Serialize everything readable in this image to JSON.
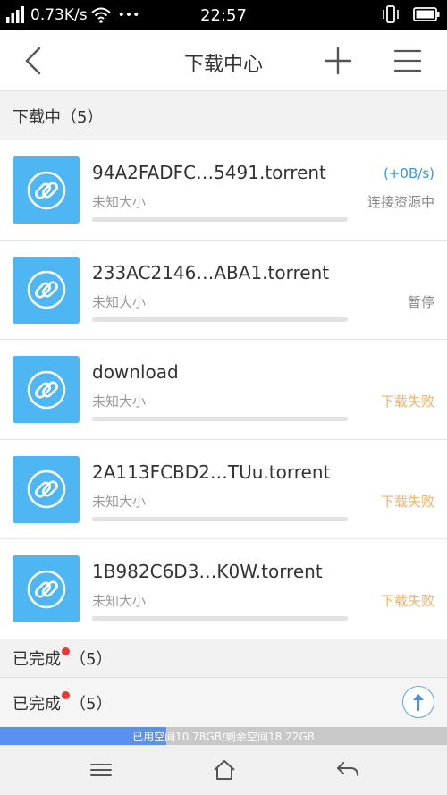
{
  "status_bar": {
    "speed": "0.73K/s",
    "dots": "•••",
    "time": "22:57"
  },
  "header": {
    "title": "下载中心"
  },
  "downloading": {
    "label": "下载中",
    "count": "（5）",
    "items": [
      {
        "name": "94A2FADFC…5491.torrent",
        "size": "未知大小",
        "speed": "(+0B/s)",
        "status": "连接资源中"
      },
      {
        "name": "233AC2146…ABA1.torrent",
        "size": "未知大小",
        "speed": "",
        "status": "暂停"
      },
      {
        "name": "download",
        "size": "未知大小",
        "speed": "",
        "status": "下载失败"
      },
      {
        "name": "2A113FCBD2…TUu.torrent",
        "size": "未知大小",
        "speed": "",
        "status": "下载失败"
      },
      {
        "name": "1B982C6D3…K0W.torrent",
        "size": "未知大小",
        "speed": "",
        "status": "下载失败"
      }
    ]
  },
  "completed": {
    "label": "已完成",
    "count": "（5）"
  },
  "bottom_panel": {
    "label": "已完成",
    "count": "（5）"
  },
  "storage": {
    "text": "已用空间10.78GB/剩余空间18.22GB",
    "used_fraction": 0.372
  },
  "colors": {
    "accent": "#4fb6f4",
    "fail": "#f4b26a",
    "speed": "#2a9ae6",
    "badge": "#e53935"
  }
}
